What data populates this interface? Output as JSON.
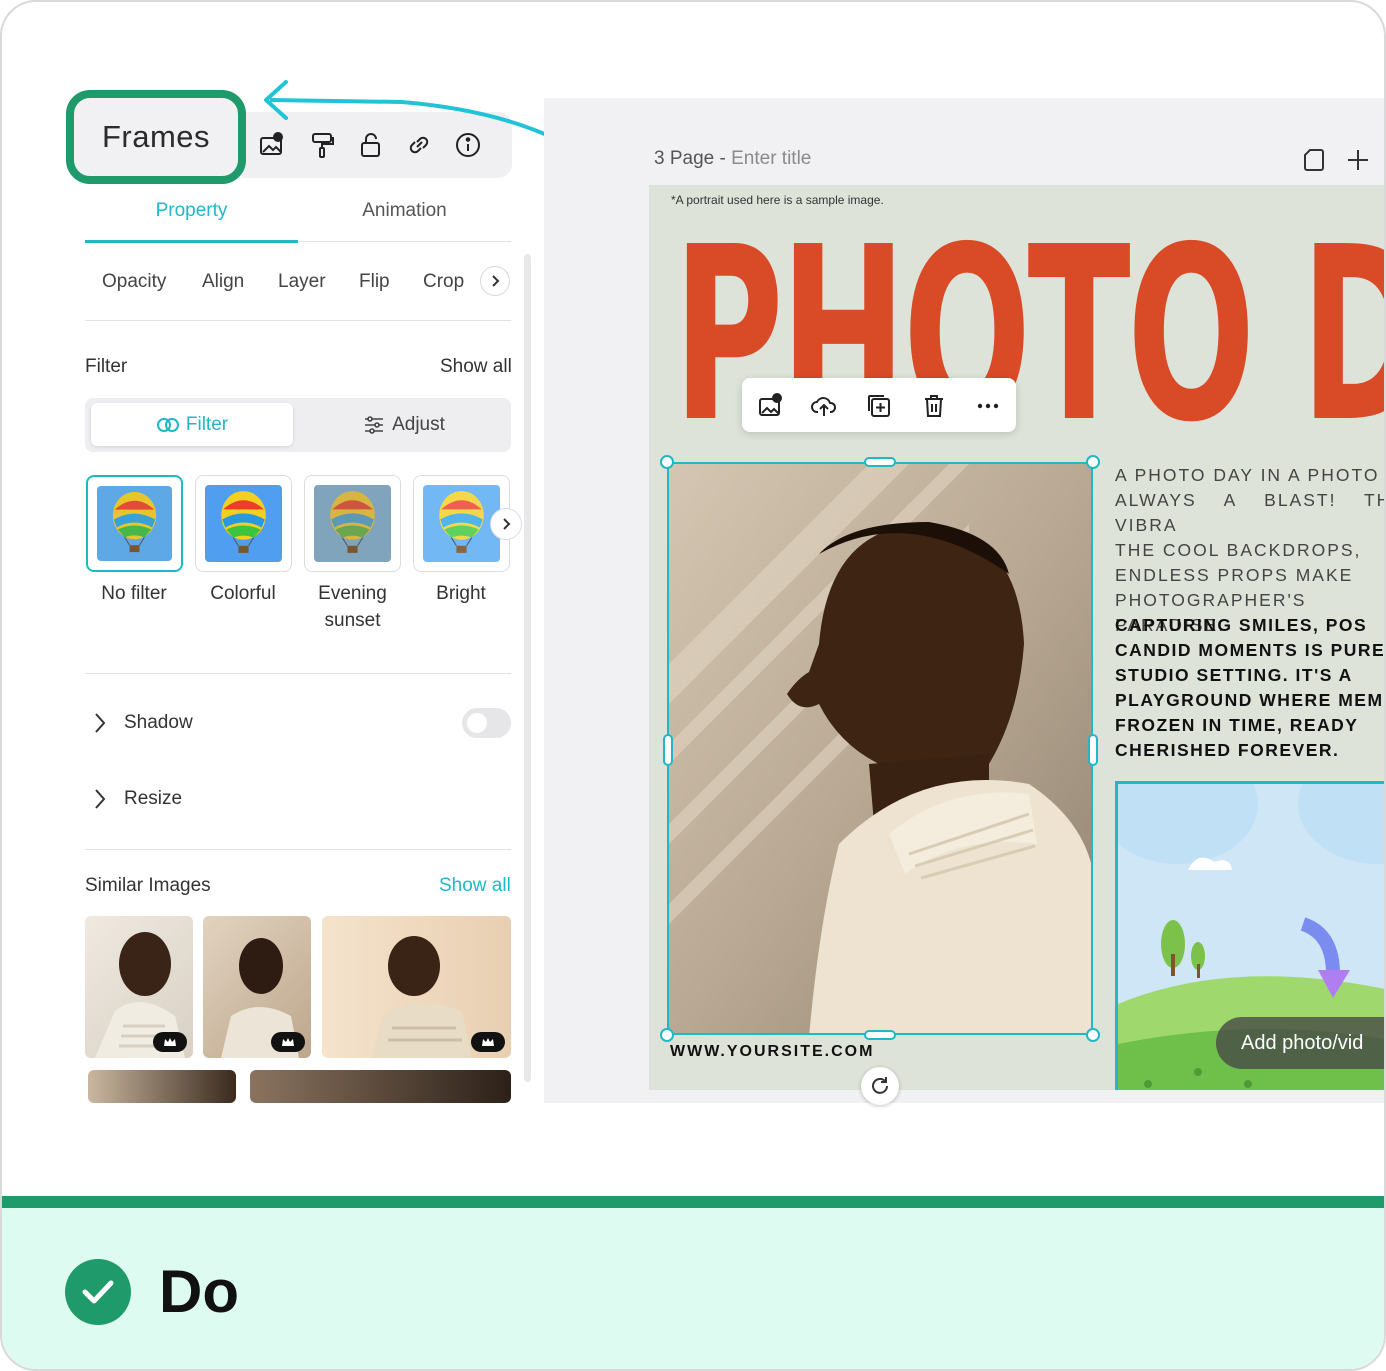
{
  "panel": {
    "frames_label": "Frames",
    "toolbar_icons": [
      "replace-image-icon",
      "format-painter-icon",
      "unlock-icon",
      "link-icon",
      "info-icon"
    ],
    "tabs": [
      {
        "label": "Property",
        "active": true
      },
      {
        "label": "Animation",
        "active": false
      }
    ],
    "subtabs": [
      "Opacity",
      "Align",
      "Layer",
      "Flip",
      "Crop"
    ],
    "filter": {
      "title": "Filter",
      "show_all": "Show all",
      "segment_filter": "Filter",
      "segment_adjust": "Adjust",
      "presets": [
        {
          "label": "No filter",
          "selected": true
        },
        {
          "label": "Colorful",
          "selected": false
        },
        {
          "label": "Evening sunset",
          "selected": false
        },
        {
          "label": "Bright",
          "selected": false
        }
      ]
    },
    "shadow": {
      "label": "Shadow",
      "enabled": false
    },
    "resize": {
      "label": "Resize"
    },
    "similar": {
      "title": "Similar Images",
      "show_all": "Show all"
    }
  },
  "canvas": {
    "page_number": "3 Page -",
    "page_title_placeholder": "Enter title",
    "disclaimer": "*A portrait used here is a sample image.",
    "headline": "PHOTO DA",
    "paragraph1": "A PHOTO DAY IN A PHOTO\nALWAYS A BLAST! THE VIBRA\nTHE COOL BACKDROPS,\nENDLESS PROPS MAKE\nPHOTOGRAPHER'S PARADISE.",
    "paragraph2": "CAPTURING SMILES, POS\nCANDID MOMENTS IS PURE\nSTUDIO SETTING. IT'S A\nPLAYGROUND WHERE MEMO\nFROZEN IN TIME, READY\nCHERISHED FOREVER.",
    "website": "WWW.YOURSITE.COM",
    "add_photo": "Add photo/vid"
  },
  "footer": {
    "label": "Do"
  },
  "colors": {
    "accent": "#20b8c7",
    "brand_green": "#1f9a6a",
    "headline": "#d94a26"
  }
}
